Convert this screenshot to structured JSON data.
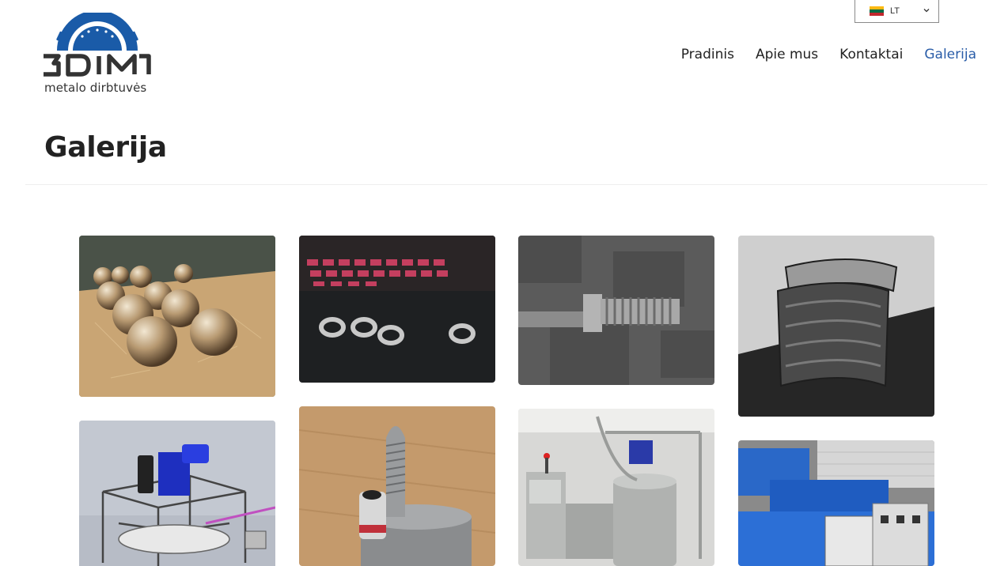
{
  "header": {
    "logo": {
      "wordmark": "3DIM",
      "tagline": "metalo dirbtuvės"
    },
    "language": {
      "code": "LT"
    },
    "nav": [
      {
        "label": "Pradinis"
      },
      {
        "label": "Apie mus"
      },
      {
        "label": "Kontaktai"
      },
      {
        "label": "Galerija",
        "active": true
      }
    ]
  },
  "page": {
    "title": "Galerija"
  },
  "colors": {
    "accent": "#2a5da8",
    "logo_blue": "#1a5ba8",
    "logo_dark": "#333333"
  },
  "gallery": [
    {
      "subject": "polished metal spheres on workbench"
    },
    {
      "subject": "knurled rings near keyboard"
    },
    {
      "subject": "threaded steel bolt"
    },
    {
      "subject": "stacked curved steel segments"
    },
    {
      "subject": "CAD model of blue gear motor frame"
    },
    {
      "subject": "threaded pin on steel disc"
    },
    {
      "subject": "stainless steel tank machine"
    },
    {
      "subject": "blue industrial machine with control box"
    }
  ]
}
